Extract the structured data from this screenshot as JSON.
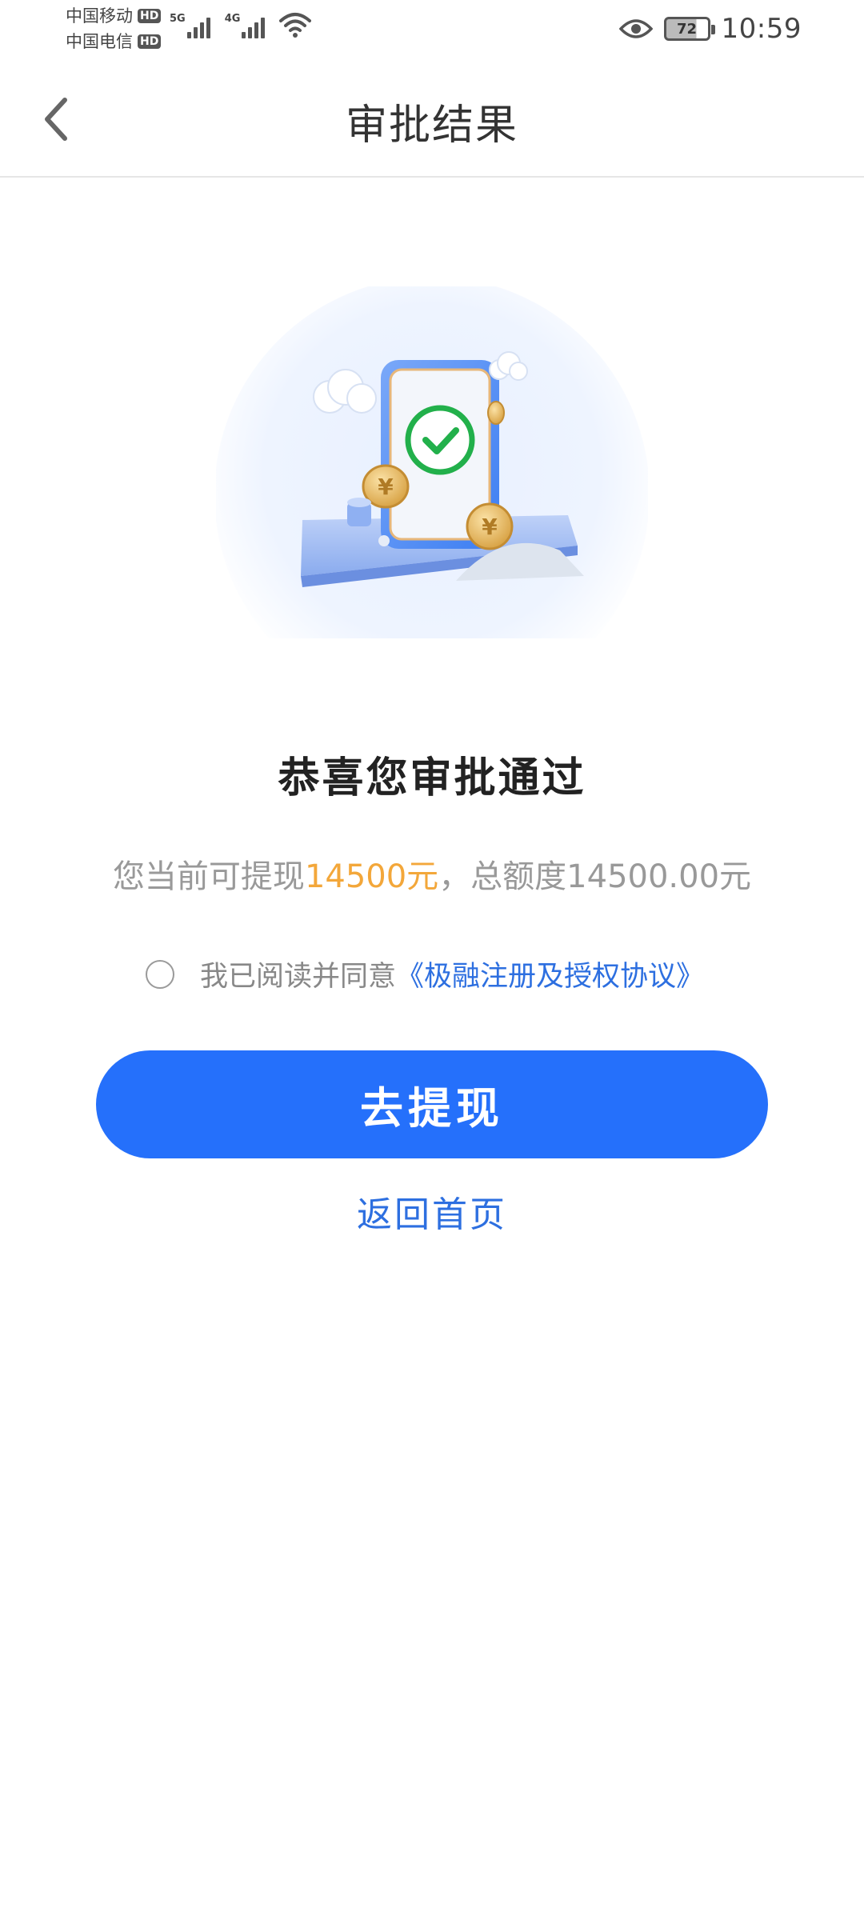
{
  "status_bar": {
    "carrier_1": "中国移动",
    "carrier_2": "中国电信",
    "hd_badge": "HD",
    "network_1": "5G",
    "network_2": "4G",
    "battery_level": "72",
    "time": "10:59",
    "icons": [
      "signal-icon",
      "wifi-icon",
      "eye-icon",
      "battery-icon"
    ]
  },
  "header": {
    "title": "审批结果",
    "back_icon": "chevron-left-icon"
  },
  "illustration": {
    "icon": "approved-phone-illustration"
  },
  "result": {
    "title": "恭喜您审批通过",
    "amount_prefix": "您当前可提现",
    "amount_value": "14500元",
    "amount_suffix": "，总额度14500.00元"
  },
  "agreement": {
    "checked": false,
    "text": "我已阅读并同意",
    "link": "《极融注册及授权协议》"
  },
  "actions": {
    "withdraw_label": "去提现",
    "home_label": "返回首页"
  },
  "colors": {
    "primary": "#2570fb",
    "link": "#2d6fe0",
    "highlight": "#f3a73a",
    "success": "#22b04b"
  }
}
